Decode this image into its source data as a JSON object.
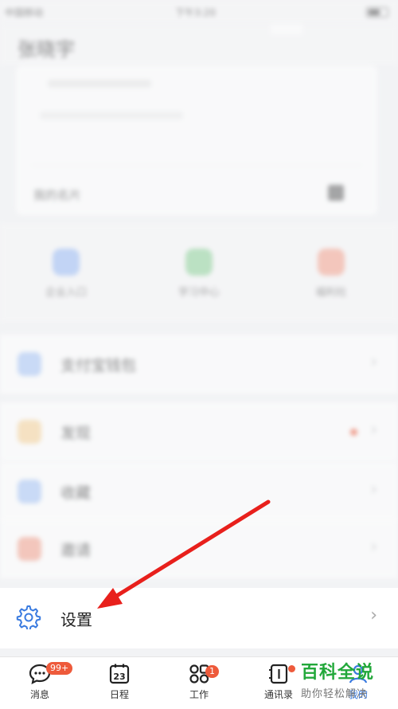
{
  "status_bar": {
    "carrier": "中国移动",
    "time": "下午3:20"
  },
  "profile": {
    "name": "张晓宇",
    "card_label": "我的名片"
  },
  "quick_actions": [
    {
      "label": "企业入口",
      "color": "#9bbcf5"
    },
    {
      "label": "学习中心",
      "color": "#8fd39b"
    },
    {
      "label": "福利社",
      "color": "#f4a38f"
    }
  ],
  "menu_rows": [
    {
      "label": "支付宝钱包",
      "color": "#a8c6f7"
    },
    {
      "label": "发现",
      "color": "#f8d49a"
    },
    {
      "label": "收藏",
      "color": "#a8c6f7"
    },
    {
      "label": "邀请",
      "color": "#f4a38f"
    }
  ],
  "settings": {
    "label": "设置",
    "chevron": "›"
  },
  "tabbar": {
    "tabs": [
      {
        "label": "消息",
        "badge": "99+"
      },
      {
        "label": "日程",
        "date": "23"
      },
      {
        "label": "工作",
        "badge": "1"
      },
      {
        "label": "通讯录"
      },
      {
        "label": "我的"
      }
    ]
  },
  "watermark": {
    "title": "百科全说",
    "subtitle": "助你轻松解决"
  },
  "colors": {
    "accent": "#3a7be0",
    "badge": "#ee5a3b",
    "watermark": "#22a83a",
    "arrow": "#e8201c"
  }
}
